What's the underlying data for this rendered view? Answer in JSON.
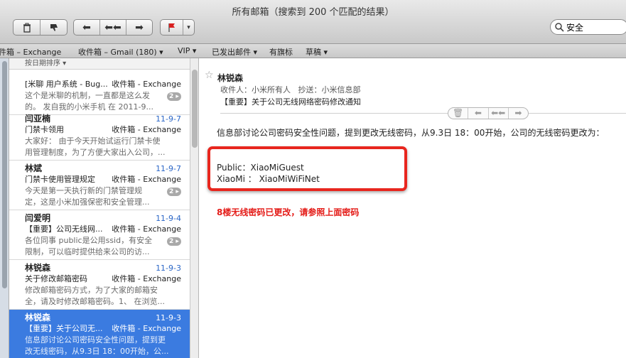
{
  "window": {
    "title": "所有邮箱（搜索到 200 个匹配的结果）"
  },
  "toolbar": {
    "delete_icon": "trash-icon",
    "junk_icon": "thumbs-down-icon",
    "reply_icon": "reply-icon",
    "reply_all_icon": "reply-all-icon",
    "forward_icon": "forward-icon",
    "flag_icon": "flag-icon",
    "flag_color": "#d82020",
    "search_value": "安全"
  },
  "favorites": [
    "件箱 – Exchange",
    "收件箱 – Gmail (180) ▾",
    "VIP ▾",
    "已发出邮件 ▾",
    "有旗标",
    "草稿 ▾"
  ],
  "list": {
    "sort_label": "按日期排序 ▾",
    "messages": [
      {
        "sender": "",
        "date": "",
        "subject": "[米聊 用户系统 - Bug...",
        "mailbox": "收件箱 - Exchange",
        "preview1": "这个是米聊的机制，一直都是这么发",
        "preview2": "的。 发自我的小米手机 在 2011-9...",
        "count": "2 ▸"
      },
      {
        "sender": "闫亚楠",
        "date": "11-9-7",
        "subject": "门禁卡领用",
        "mailbox": "收件箱 - Exchange",
        "preview1": "大家好：  由于今天开始试运行门禁卡使",
        "preview2": "用管理制度，为了方便大家出入公司，...",
        "count": ""
      },
      {
        "sender": "林斌",
        "date": "11-9-7",
        "subject": "门禁卡使用管理规定",
        "mailbox": "收件箱 - Exchange",
        "preview1": "今天是第一天执行新的门禁管理规",
        "preview2": "定，这是小米加强保密和安全管理...",
        "count": "2 ▸"
      },
      {
        "sender": "闫爱明",
        "date": "11-9-4",
        "subject": "【重要】公司无线网...",
        "mailbox": "收件箱 - Exchange",
        "preview1": "各位同事 public是公用ssid，有安全",
        "preview2": "限制，可以临时提供给来公司的访...",
        "count": "2 ▸"
      },
      {
        "sender": "林锐森",
        "date": "11-9-3",
        "subject": "关于修改邮箱密码",
        "mailbox": "收件箱 - Exchange",
        "preview1": "修改邮箱密码方式，为了大家的邮箱安",
        "preview2": "全，请及时修改邮箱密码。1、 在浏览...",
        "count": ""
      },
      {
        "sender": "林锐森",
        "date": "11-9-3",
        "subject": "【重要】关于公司无...",
        "mailbox": "收件箱 - Exchange",
        "preview1": "信息部讨论公司密码安全性问题，提到更",
        "preview2": "改无线密码，从9.3日 18：00开始，公...",
        "count": ""
      }
    ]
  },
  "message": {
    "from": "林锐森",
    "to_label": "收件人：",
    "to": "小米所有人",
    "cc_label": "抄送：",
    "cc": "小米信息部",
    "subject": "【重要】关于公司无线网络密码修改通知",
    "body_intro": "信息部讨论公司密码安全性问题，提到更改无线密码，从9.3日 18：00开始，公司的无线密码更改为：",
    "credential_1": "Public：XiaoMiGuest",
    "credential_2": "XiaoMi ： XiaoMiWiFiNet",
    "notice": "8楼无线密码已更改，请参照上面密码",
    "highlight_color": "#e8261e",
    "notice_color": "#e41b17"
  }
}
